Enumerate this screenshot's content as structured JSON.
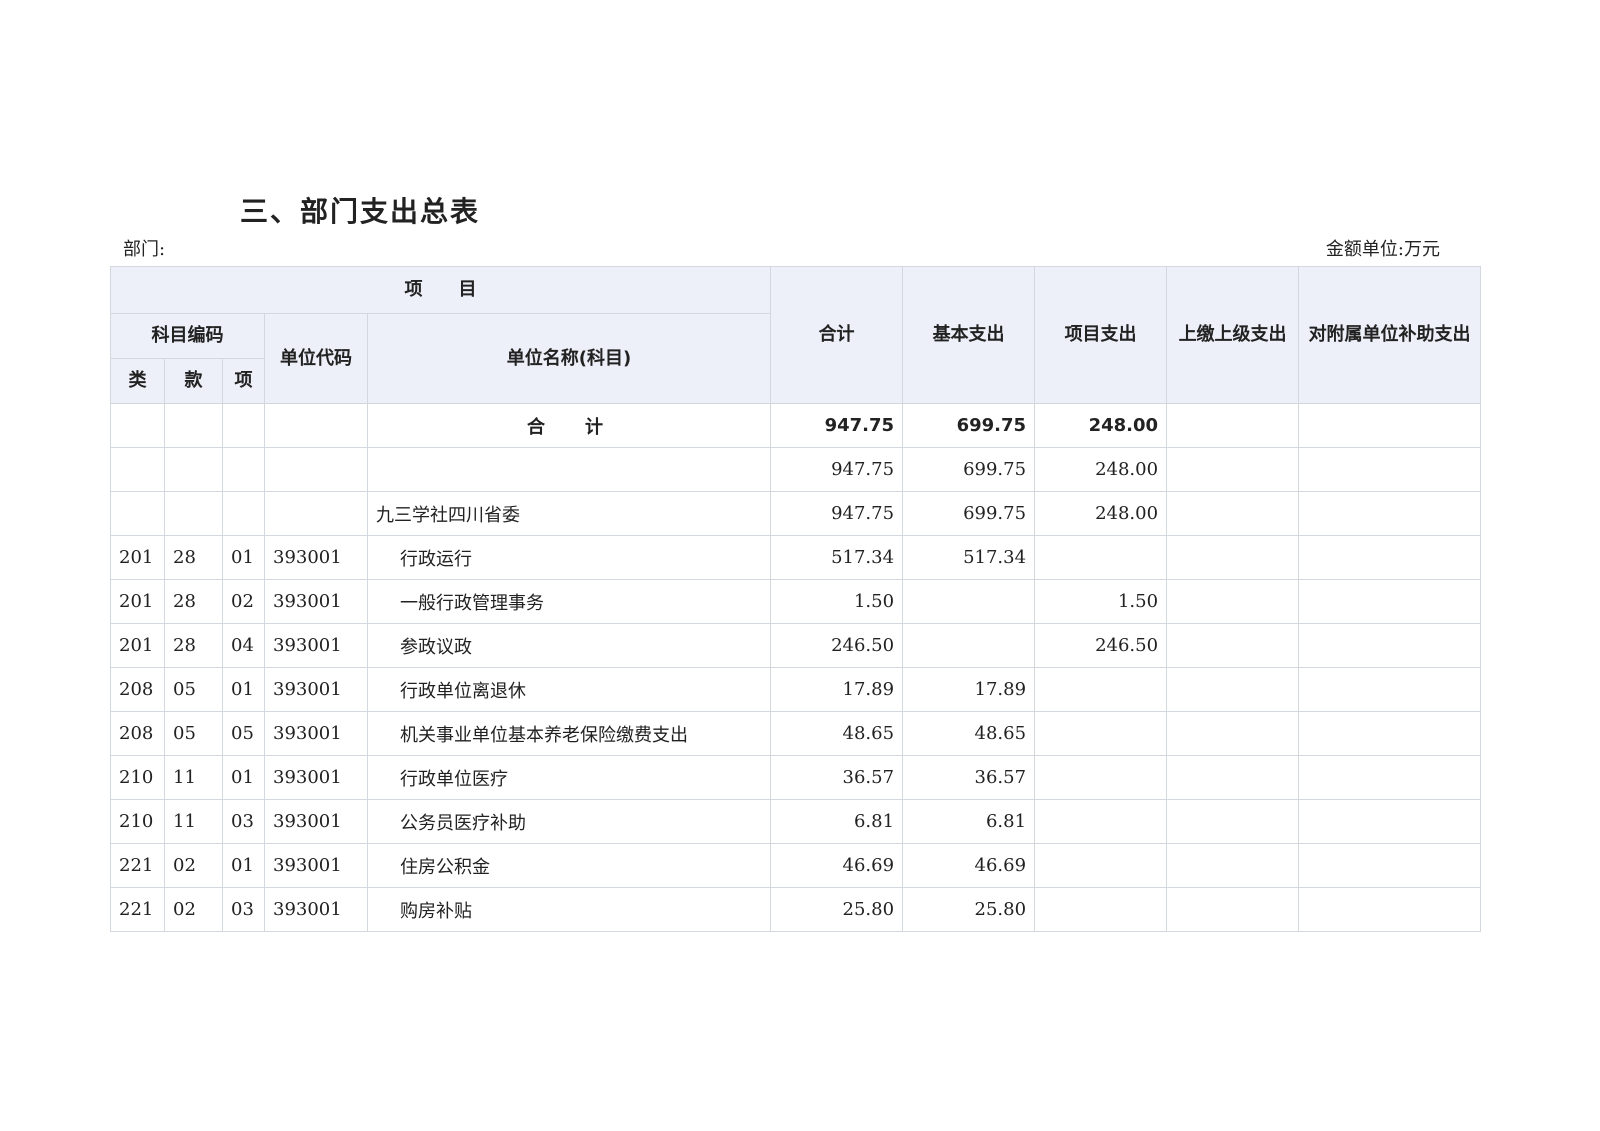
{
  "title": "三、部门支出总表",
  "dept_label": "部门:",
  "unit_label": "金额单位:万元",
  "header": {
    "project": "项　　目",
    "subject_code": "科目编码",
    "lei": "类",
    "kuan": "款",
    "xiang": "项",
    "unit_code": "单位代码",
    "unit_name": "单位名称(科目)",
    "total": "合计",
    "basic": "基本支出",
    "project_exp": "项目支出",
    "upper": "上缴上级支出",
    "subsidiary": "对附属单位补助支出"
  },
  "rows": [
    {
      "lei": "",
      "kuan": "",
      "xiang": "",
      "code": "",
      "name": "合计",
      "total": "947.75",
      "basic": "699.75",
      "project": "248.00",
      "upper": "",
      "sub": ""
    },
    {
      "lei": "",
      "kuan": "",
      "xiang": "",
      "code": "",
      "name": "",
      "total": "947.75",
      "basic": "699.75",
      "project": "248.00",
      "upper": "",
      "sub": ""
    },
    {
      "lei": "",
      "kuan": "",
      "xiang": "",
      "code": "",
      "name": "九三学社四川省委",
      "total": "947.75",
      "basic": "699.75",
      "project": "248.00",
      "upper": "",
      "sub": ""
    },
    {
      "lei": "201",
      "kuan": "28",
      "xiang": "01",
      "code": "393001",
      "name": "行政运行",
      "total": "517.34",
      "basic": "517.34",
      "project": "",
      "upper": "",
      "sub": ""
    },
    {
      "lei": "201",
      "kuan": "28",
      "xiang": "02",
      "code": "393001",
      "name": "一般行政管理事务",
      "total": "1.50",
      "basic": "",
      "project": "1.50",
      "upper": "",
      "sub": ""
    },
    {
      "lei": "201",
      "kuan": "28",
      "xiang": "04",
      "code": "393001",
      "name": "参政议政",
      "total": "246.50",
      "basic": "",
      "project": "246.50",
      "upper": "",
      "sub": ""
    },
    {
      "lei": "208",
      "kuan": "05",
      "xiang": "01",
      "code": "393001",
      "name": "行政单位离退休",
      "total": "17.89",
      "basic": "17.89",
      "project": "",
      "upper": "",
      "sub": ""
    },
    {
      "lei": "208",
      "kuan": "05",
      "xiang": "05",
      "code": "393001",
      "name": "机关事业单位基本养老保险缴费支出",
      "total": "48.65",
      "basic": "48.65",
      "project": "",
      "upper": "",
      "sub": ""
    },
    {
      "lei": "210",
      "kuan": "11",
      "xiang": "01",
      "code": "393001",
      "name": "行政单位医疗",
      "total": "36.57",
      "basic": "36.57",
      "project": "",
      "upper": "",
      "sub": ""
    },
    {
      "lei": "210",
      "kuan": "11",
      "xiang": "03",
      "code": "393001",
      "name": "公务员医疗补助",
      "total": "6.81",
      "basic": "6.81",
      "project": "",
      "upper": "",
      "sub": ""
    },
    {
      "lei": "221",
      "kuan": "02",
      "xiang": "01",
      "code": "393001",
      "name": "住房公积金",
      "total": "46.69",
      "basic": "46.69",
      "project": "",
      "upper": "",
      "sub": ""
    },
    {
      "lei": "221",
      "kuan": "02",
      "xiang": "03",
      "code": "393001",
      "name": "购房补贴",
      "total": "25.80",
      "basic": "25.80",
      "project": "",
      "upper": "",
      "sub": ""
    }
  ]
}
